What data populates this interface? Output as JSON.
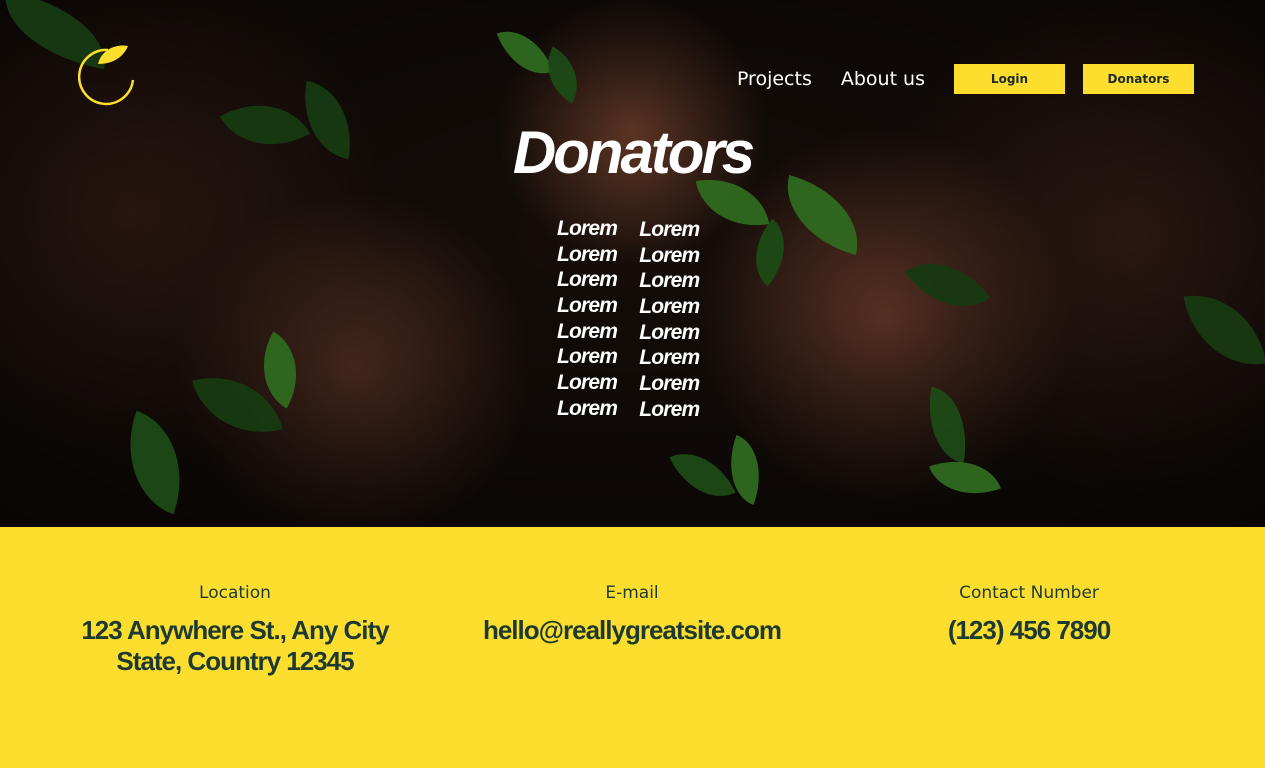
{
  "nav": {
    "links": [
      "Projects",
      "About us"
    ],
    "buttons": [
      "Login",
      "Donators"
    ]
  },
  "hero": {
    "title": "Donators",
    "names_left": [
      "Lorem",
      "Lorem",
      "Lorem",
      "Lorem",
      "Lorem",
      "Lorem",
      "Lorem",
      "Lorem"
    ],
    "names_right": [
      "Lorem",
      "Lorem",
      "Lorem",
      "Lorem",
      "Lorem",
      "Lorem",
      "Lorem",
      "Lorem"
    ]
  },
  "footer": {
    "location": {
      "label": "Location",
      "line1": "123 Anywhere St., Any City",
      "line2": "State, Country 12345"
    },
    "email": {
      "label": "E-mail",
      "value": "hello@reallygreatsite.com"
    },
    "phone": {
      "label": "Contact Number",
      "value": "(123) 456 7890"
    }
  },
  "colors": {
    "accent": "#fddd2d",
    "footer_text": "#1d3a31"
  },
  "icons": {
    "logo": "leaf-circle-logo-icon"
  }
}
